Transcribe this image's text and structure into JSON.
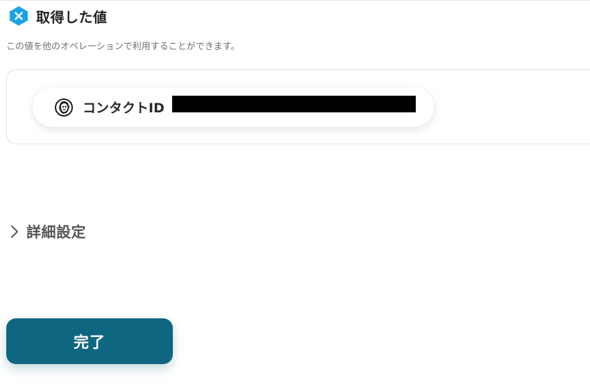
{
  "section": {
    "title": "取得した値",
    "description": "この値を他のオペレーションで利用することができます。",
    "badge_icon": "x-icon",
    "badge_color": "#1aa4e8"
  },
  "output_values": [
    {
      "app_icon": "mailchimp-icon",
      "label": "コンタクトID",
      "value_redacted": true
    }
  ],
  "advanced": {
    "label": "詳細設定",
    "icon": "chevron-right-icon"
  },
  "actions": {
    "done_label": "完了",
    "done_color": "#0f6680"
  }
}
